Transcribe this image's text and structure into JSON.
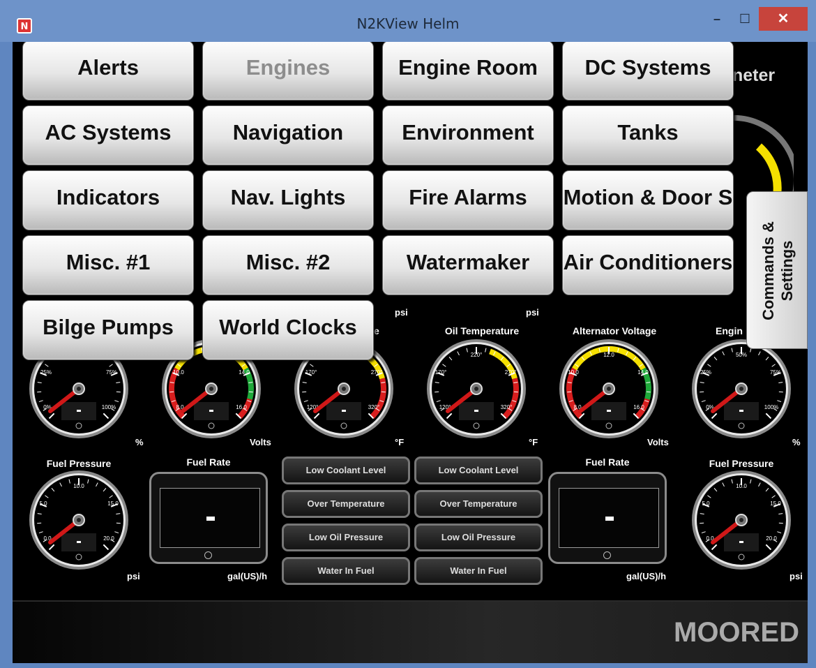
{
  "window": {
    "title": "N2KView Helm",
    "minimize": "–",
    "maximize": "☐",
    "close": "✕",
    "icon": "N"
  },
  "background_partial": {
    "tachometer_fragment": "neter",
    "psi_left": "psi",
    "psi_right": "psi"
  },
  "menu": {
    "buttons": [
      "Alerts",
      "Engines",
      "Engine Room",
      "DC Systems",
      "AC Systems",
      "Navigation",
      "Environment",
      "Tanks",
      "Indicators",
      "Nav. Lights",
      "Fire Alarms",
      "Motion & Door S",
      "Misc. #1",
      "Misc. #2",
      "Watermaker",
      "Air Conditioners",
      "Bilge Pumps",
      "World Clocks"
    ],
    "dimmed": "Engines"
  },
  "side_tab": {
    "line1": "Commands &",
    "line2": "Settings"
  },
  "gauges_row1": [
    {
      "label": "",
      "unit": "%",
      "ticks": [
        "25%",
        "75%",
        "0%",
        "100%"
      ],
      "value": "-"
    },
    {
      "label": "",
      "unit": "Volts",
      "ticks": [
        "10.0",
        "14.0",
        "8.0",
        "16.0"
      ],
      "value": "-"
    },
    {
      "label": "e",
      "unit": "°F",
      "ticks": [
        "170°",
        "270°",
        "120°",
        "320°"
      ],
      "value": "-"
    },
    {
      "label": "Oil Temperature",
      "unit": "°F",
      "ticks": [
        "220°",
        "170°",
        "270°",
        "120°",
        "320°"
      ],
      "value": "-"
    },
    {
      "label": "Alternator Voltage",
      "unit": "Volts",
      "ticks": [
        "12.0",
        "10.0",
        "14.0",
        "8.0",
        "16.0"
      ],
      "value": "-"
    },
    {
      "label": "Engin",
      "unit": "%",
      "ticks": [
        "50%",
        "25%",
        "75%",
        "0%",
        "100%"
      ],
      "value": "-"
    }
  ],
  "row2": {
    "fuel_pressure_left": {
      "label": "Fuel Pressure",
      "unit": "psi",
      "ticks": [
        "10.0",
        "5.0",
        "15.0",
        "0.0",
        "20.0"
      ]
    },
    "fuel_rate_left": {
      "label": "Fuel Rate",
      "unit": "gal(US)/h"
    },
    "alarms_left": [
      "Low Coolant Level",
      "Over Temperature",
      "Low Oil Pressure",
      "Water In Fuel"
    ],
    "alarms_right": [
      "Low Coolant Level",
      "Over Temperature",
      "Low Oil Pressure",
      "Water In Fuel"
    ],
    "fuel_rate_right": {
      "label": "Fuel Rate",
      "unit": "gal(US)/h"
    },
    "fuel_pressure_right": {
      "label": "Fuel Pressure",
      "unit": "psi",
      "ticks": [
        "10.0",
        "5.0",
        "15.0",
        "0.0",
        "20.0"
      ]
    }
  },
  "status": {
    "text": "MOORED"
  },
  "colors": {
    "green": "#1fa83a",
    "yellow": "#f5e000",
    "red": "#d81e1e",
    "needle": "#d01818"
  }
}
